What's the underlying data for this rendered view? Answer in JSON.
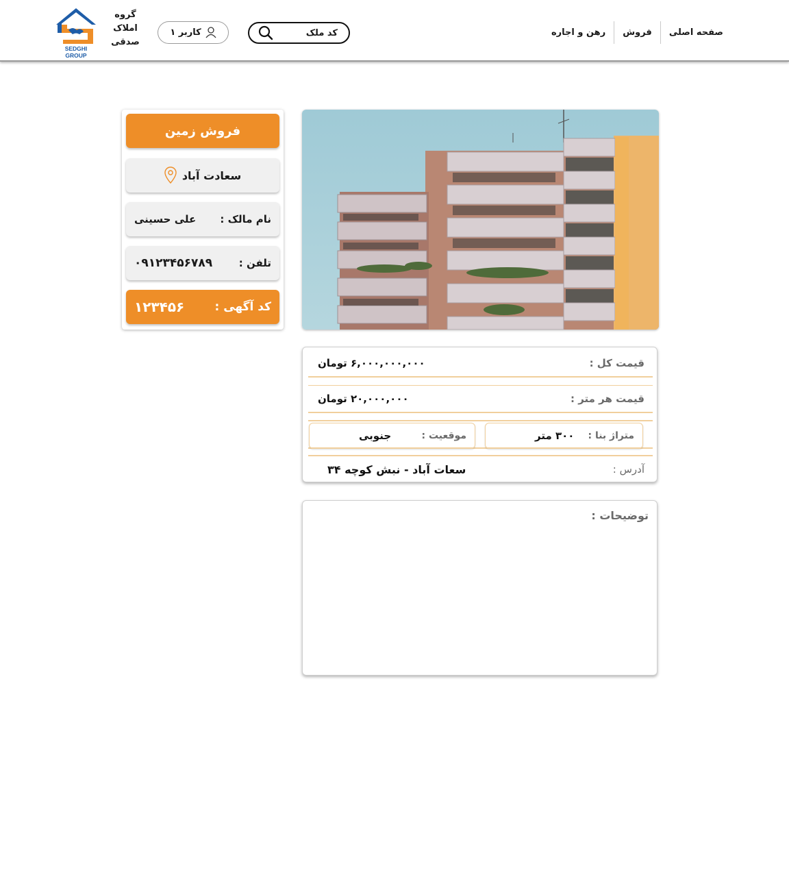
{
  "brand": {
    "logo_text": "SEDGHI GROUP",
    "name_lines": [
      "گروه",
      "املاک",
      "صدقی"
    ],
    "colors": {
      "blue": "#1e5da8",
      "orange": "#ee8e28"
    }
  },
  "header": {
    "user_label": "کاربر ۱",
    "user_icon": "user-icon",
    "search_placeholder": "کد ملک",
    "search_icon": "search-icon",
    "nav": [
      "صفحه اصلی",
      "فروش",
      "رهن و اجاره"
    ]
  },
  "listing": {
    "title": "فروش زمین",
    "location": "سعادت آباد",
    "location_icon": "map-pin-icon",
    "owner_label": "نام مالک :",
    "owner_value": "علی حسینی",
    "phone_label": "تلفن :",
    "phone_value": "۰۹۱۲۳۴۵۶۷۸۹",
    "ad_code_label": "کد آگهی :",
    "ad_code_value": "۱۲۳۴۵۶"
  },
  "details": {
    "total_price_label": "قیمت کل :",
    "total_price_value": "۶,۰۰۰,۰۰۰,۰۰۰ تومان",
    "price_per_meter_label": "قیمت هر متر :",
    "price_per_meter_value": "۲۰,۰۰۰,۰۰۰ تومان",
    "area_label": "متراژ بنا :",
    "area_value": "۳۰۰ متر",
    "position_label": "موقعیت :",
    "position_value": "جنوبی",
    "address_label": "آدرس :",
    "address_value": "سعات آباد - نبش کوچه ۳۴"
  },
  "description": {
    "label": "توضیحات :",
    "text": ""
  }
}
